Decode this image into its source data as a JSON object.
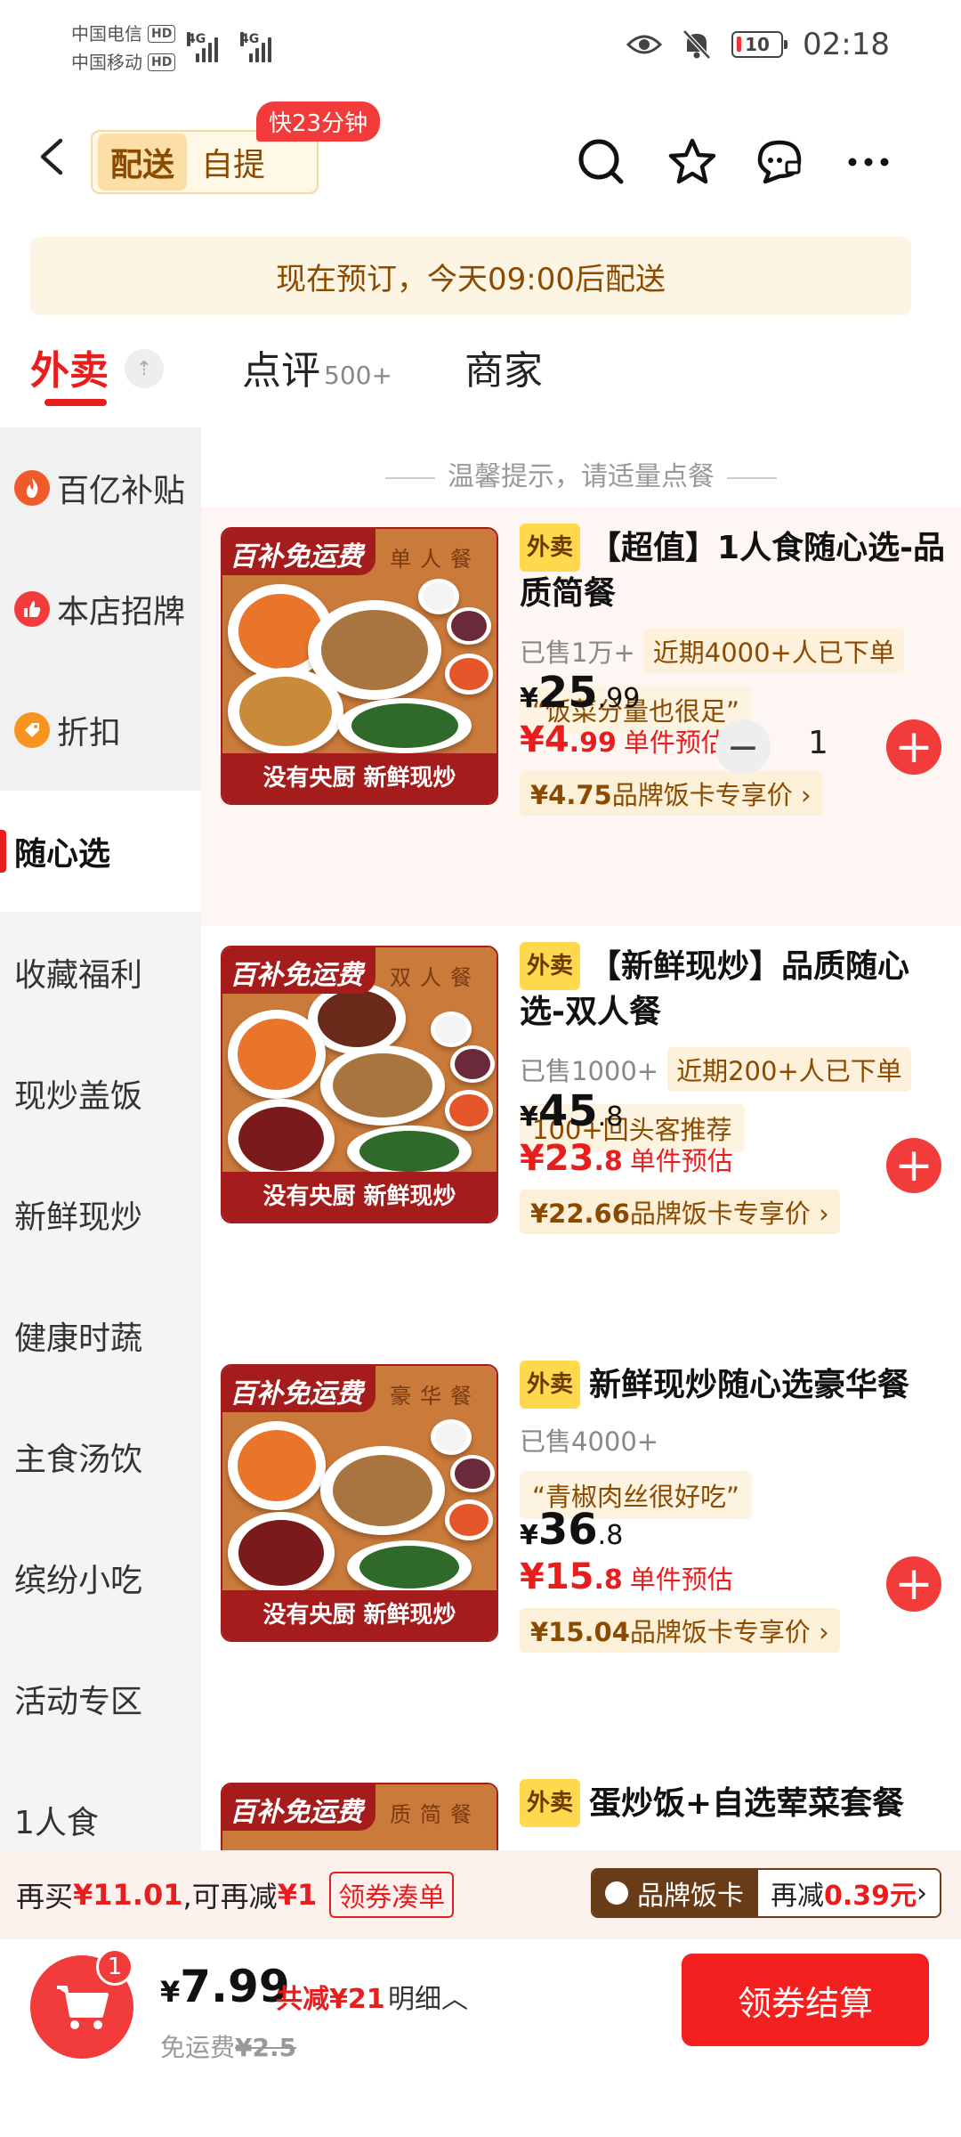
{
  "status_bar": {
    "carrier1": "中国电信",
    "carrier2": "中国移动",
    "hd": "HD",
    "net": "4G",
    "battery": "10",
    "time": "02:18"
  },
  "header": {
    "mode_active": "配送",
    "mode_inactive": "自提",
    "fast_badge": "快23分钟"
  },
  "notice": "现在预订，今天09:00后配送",
  "tabs": {
    "takeout": "外卖",
    "reviews": "点评",
    "reviews_count": "500+",
    "merchant": "商家"
  },
  "sidebar": [
    {
      "label": "百亿补贴",
      "icon": "flame-icon",
      "color": "#f05a28"
    },
    {
      "label": "本店招牌",
      "icon": "thumbs-up-icon",
      "color": "#f23b3b"
    },
    {
      "label": "折扣",
      "icon": "discount-icon",
      "color": "#f7931e"
    },
    {
      "label": "随心选"
    },
    {
      "label": "收藏福利"
    },
    {
      "label": "现炒盖饭"
    },
    {
      "label": "新鲜现炒"
    },
    {
      "label": "健康时蔬"
    },
    {
      "label": "主食汤饮"
    },
    {
      "label": "缤纷小吃"
    },
    {
      "label": "活动专区"
    },
    {
      "label": "1人食"
    }
  ],
  "tip": "温馨提示，请适量点餐",
  "food_ribbon": "百补免运费",
  "food_bottom": "没有央厨 新鲜现炒",
  "products": [
    {
      "badge": "外卖",
      "title": "【超值】1人食随心选-品质简餐",
      "sold": "已售1万+",
      "tag": "近期4000+人已下单",
      "quote": "“饭菜分量也很足”",
      "price_int": "25",
      "price_dec": ".99",
      "est_int": "¥4",
      "est_dec": ".99",
      "est_label": "单件预估",
      "pass_price": "¥4.75",
      "pass_label": "品牌饭卡专享价 ›",
      "qty": "1",
      "food_top": "单人餐"
    },
    {
      "badge": "外卖",
      "title": "【新鲜现炒】品质随心选-双人餐",
      "sold": "已售1000+",
      "tag": "近期200+人已下单",
      "quote": "100+回头客推荐",
      "price_int": "45",
      "price_dec": ".8",
      "est_int": "¥23",
      "est_dec": ".8",
      "est_label": "单件预估",
      "pass_price": "¥22.66",
      "pass_label": "品牌饭卡专享价 ›",
      "food_top": "双人餐"
    },
    {
      "badge": "外卖",
      "title": "新鲜现炒随心选豪华餐",
      "sold": "已售4000+",
      "tag": "",
      "quote": "“青椒肉丝很好吃”",
      "price_int": "36",
      "price_dec": ".8",
      "est_int": "¥15",
      "est_dec": ".8",
      "est_label": "单件预估",
      "pass_price": "¥15.04",
      "pass_label": "品牌饭卡专享价 ›",
      "food_top": "豪华餐"
    },
    {
      "badge": "外卖",
      "title": "蛋炒饭+自选荤菜套餐",
      "food_top": "质简餐"
    }
  ],
  "promo": {
    "text1": "再买",
    "amount": "¥11.01",
    "text2": ",可再减",
    "cut": "¥1",
    "coupon_btn": "领券凑单",
    "pass_name": "品牌饭卡",
    "pass_text": "再减",
    "pass_amount": "0.39元",
    "pass_arrow": "›"
  },
  "checkout": {
    "cart_count": "1",
    "currency": "¥",
    "total": "7.99",
    "discount": "共减¥21",
    "detail": "明细︿",
    "freeship_label": "免运费",
    "freeship_old": "¥2.5",
    "pay": "领券结算"
  },
  "colors": {
    "accent": "#e81e1e",
    "gold": "#8a4b00",
    "badge_yellow": "#ffd84d"
  }
}
